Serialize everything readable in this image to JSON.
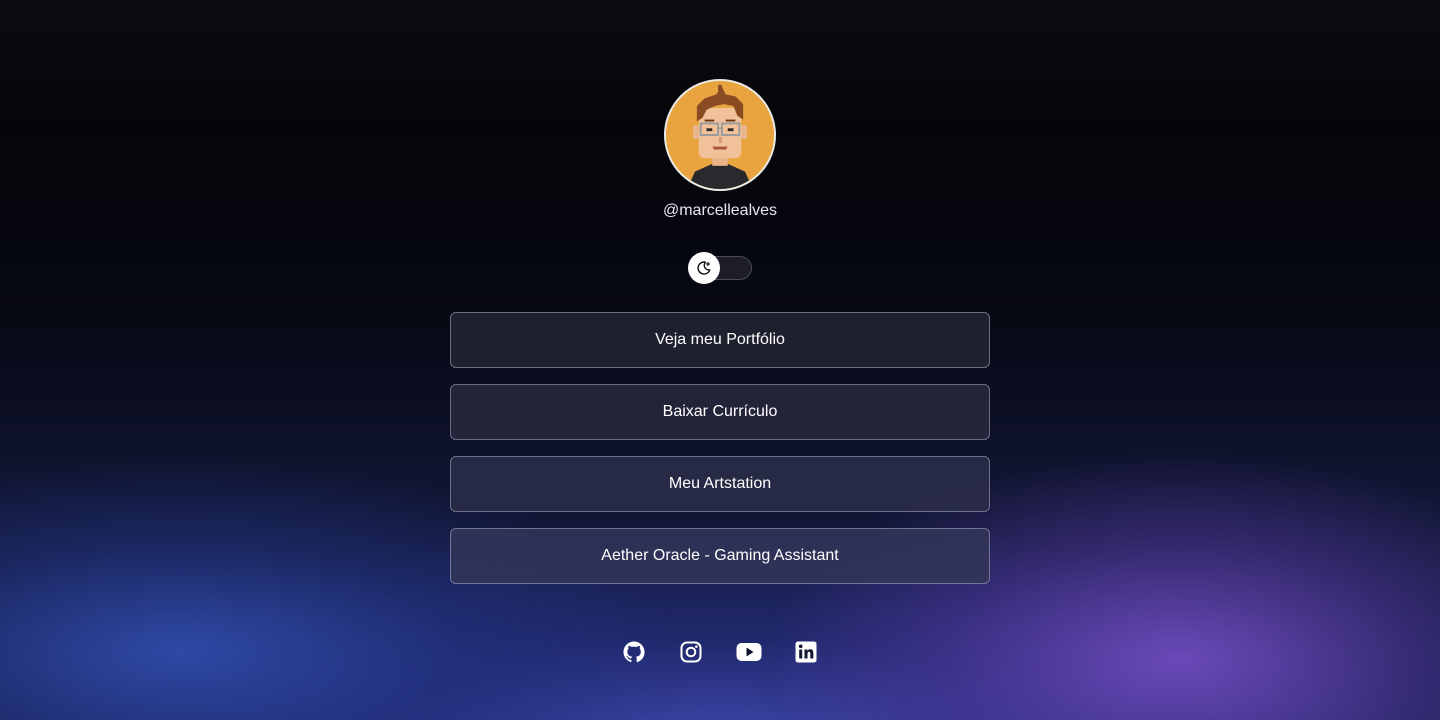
{
  "profile": {
    "username": "@marcellealves"
  },
  "theme_toggle": {
    "state": "dark",
    "icon": "moon-icon"
  },
  "links": [
    {
      "label": "Veja meu Portfólio"
    },
    {
      "label": "Baixar Currículo"
    },
    {
      "label": "Meu Artstation"
    },
    {
      "label": "Aether Oracle - Gaming Assistant"
    }
  ],
  "socials": [
    {
      "icon": "github-icon"
    },
    {
      "icon": "instagram-icon"
    },
    {
      "icon": "youtube-icon"
    },
    {
      "icon": "linkedin-icon"
    }
  ],
  "colors": {
    "avatar_bg": "#e9a43f",
    "button_border": "#c8c8dc",
    "accent_purple": "#7850c8",
    "accent_blue": "#3250b4"
  }
}
